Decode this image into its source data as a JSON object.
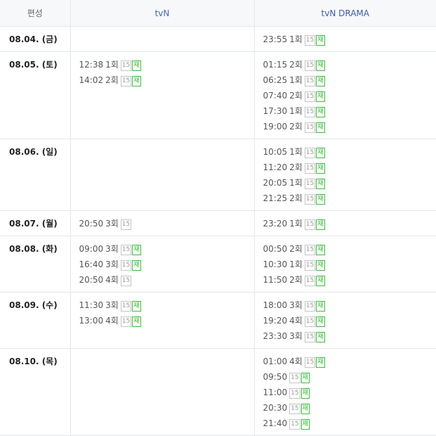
{
  "header": {
    "date_col": "편성",
    "tvn_col": "tvN",
    "drama_col": "tvN DRAMA"
  },
  "colors": {
    "rerun_badge": "#2cb22c",
    "age_badge": "#9a9a9a",
    "channel_header": "#3d5ba8"
  },
  "rows": [
    {
      "date": "08.04. (금)",
      "tvn": [],
      "drama": [
        {
          "time": "23:55",
          "ep": "1회",
          "age": "15",
          "rerun": "재"
        }
      ]
    },
    {
      "date": "08.05. (토)",
      "tvn": [
        {
          "time": "12:38",
          "ep": "1회",
          "age": "15",
          "rerun": "재"
        },
        {
          "time": "14:02",
          "ep": "2회",
          "age": "15",
          "rerun": "재"
        }
      ],
      "drama": [
        {
          "time": "01:15",
          "ep": "2회",
          "age": "15",
          "rerun": "재"
        },
        {
          "time": "06:25",
          "ep": "1회",
          "age": "15",
          "rerun": "재"
        },
        {
          "time": "07:40",
          "ep": "2회",
          "age": "15",
          "rerun": "재"
        },
        {
          "time": "17:30",
          "ep": "1회",
          "age": "15",
          "rerun": "재"
        },
        {
          "time": "19:00",
          "ep": "2회",
          "age": "15",
          "rerun": "재"
        }
      ]
    },
    {
      "date": "08.06. (일)",
      "tvn": [],
      "drama": [
        {
          "time": "10:05",
          "ep": "1회",
          "age": "15",
          "rerun": "재"
        },
        {
          "time": "11:20",
          "ep": "2회",
          "age": "15",
          "rerun": "재"
        },
        {
          "time": "20:05",
          "ep": "1회",
          "age": "15",
          "rerun": "재"
        },
        {
          "time": "21:25",
          "ep": "2회",
          "age": "15",
          "rerun": "재"
        }
      ]
    },
    {
      "date": "08.07. (월)",
      "tvn": [
        {
          "time": "20:50",
          "ep": "3회",
          "age": "15",
          "rerun": ""
        }
      ],
      "drama": [
        {
          "time": "23:20",
          "ep": "1회",
          "age": "15",
          "rerun": "재"
        }
      ]
    },
    {
      "date": "08.08. (화)",
      "tvn": [
        {
          "time": "09:00",
          "ep": "3회",
          "age": "15",
          "rerun": "재"
        },
        {
          "time": "16:40",
          "ep": "3회",
          "age": "15",
          "rerun": "재"
        },
        {
          "time": "20:50",
          "ep": "4회",
          "age": "15",
          "rerun": ""
        }
      ],
      "drama": [
        {
          "time": "00:50",
          "ep": "2회",
          "age": "15",
          "rerun": "재"
        },
        {
          "time": "10:30",
          "ep": "1회",
          "age": "15",
          "rerun": "재"
        },
        {
          "time": "11:50",
          "ep": "2회",
          "age": "15",
          "rerun": "재"
        }
      ]
    },
    {
      "date": "08.09. (수)",
      "tvn": [
        {
          "time": "11:30",
          "ep": "3회",
          "age": "15",
          "rerun": "재"
        },
        {
          "time": "13:00",
          "ep": "4회",
          "age": "15",
          "rerun": "재"
        }
      ],
      "drama": [
        {
          "time": "18:00",
          "ep": "3회",
          "age": "15",
          "rerun": "재"
        },
        {
          "time": "19:20",
          "ep": "4회",
          "age": "15",
          "rerun": "재"
        },
        {
          "time": "23:30",
          "ep": "3회",
          "age": "15",
          "rerun": "재"
        }
      ]
    },
    {
      "date": "08.10. (목)",
      "tvn": [],
      "drama": [
        {
          "time": "01:00",
          "ep": "4회",
          "age": "15",
          "rerun": "재"
        },
        {
          "time": "09:50",
          "ep": "",
          "age": "15",
          "rerun": "재"
        },
        {
          "time": "11:00",
          "ep": "",
          "age": "15",
          "rerun": "재"
        },
        {
          "time": "20:30",
          "ep": "",
          "age": "15",
          "rerun": "재"
        },
        {
          "time": "21:40",
          "ep": "",
          "age": "15",
          "rerun": "재"
        }
      ]
    }
  ]
}
